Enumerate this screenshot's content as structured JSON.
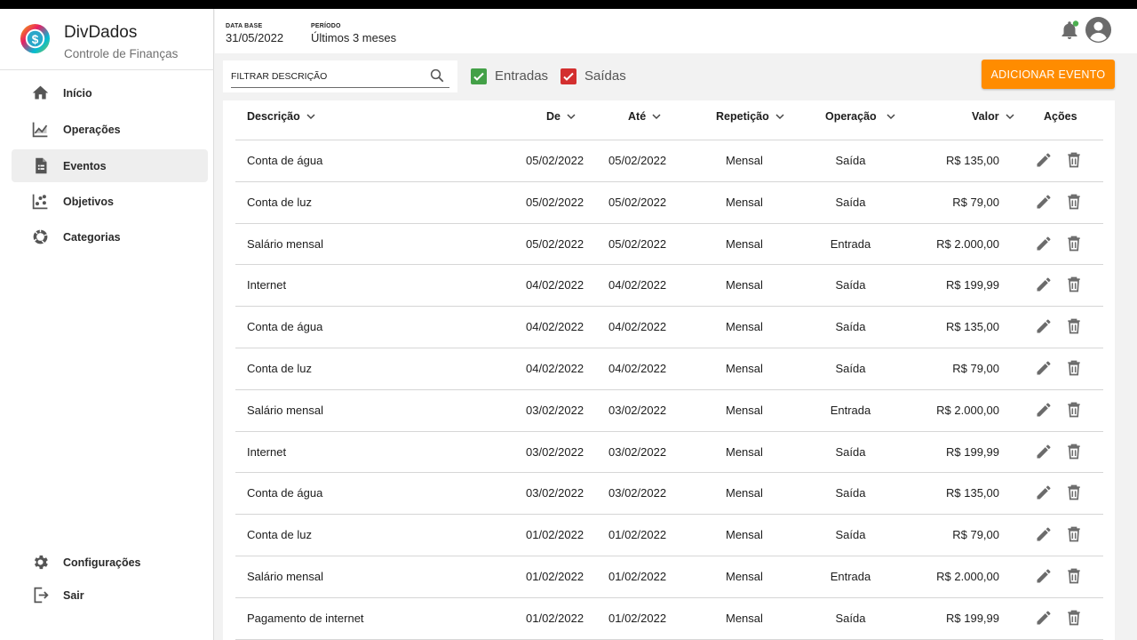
{
  "brand": {
    "title": "DivDados",
    "subtitle": "Controle de Finanças"
  },
  "nav": {
    "items": [
      {
        "label": "Início",
        "icon": "home-icon"
      },
      {
        "label": "Operações",
        "icon": "chart-line-icon"
      },
      {
        "label": "Eventos",
        "icon": "document-icon",
        "active": true
      },
      {
        "label": "Objetivos",
        "icon": "scatter-icon"
      },
      {
        "label": "Categorias",
        "icon": "donut-icon"
      }
    ],
    "bottom": [
      {
        "label": "Configurações",
        "icon": "gear-icon"
      },
      {
        "label": "Sair",
        "icon": "logout-icon"
      }
    ]
  },
  "header": {
    "database_label": "DATA BASE",
    "database_value": "31/05/2022",
    "period_label": "PERÍODO",
    "period_value": "Últimos 3 meses"
  },
  "filters": {
    "description_placeholder": "FILTRAR DESCRIÇÃO",
    "entradas_label": "Entradas",
    "entradas_checked": true,
    "saidas_label": "Saídas",
    "saidas_checked": true,
    "add_button": "ADICIONAR EVENTO"
  },
  "colors": {
    "accent": "#ff8c00",
    "entradas": "#43a047",
    "saidas": "#d32f2f",
    "notification": "#4caf50"
  },
  "table": {
    "columns": [
      "Descrição",
      "De",
      "Até",
      "Repetição",
      "Operação",
      "Valor",
      "Ações"
    ],
    "rows": [
      {
        "descricao": "Conta de água",
        "de": "05/02/2022",
        "ate": "05/02/2022",
        "repeticao": "Mensal",
        "operacao": "Saída",
        "valor": "R$ 135,00"
      },
      {
        "descricao": "Conta de luz",
        "de": "05/02/2022",
        "ate": "05/02/2022",
        "repeticao": "Mensal",
        "operacao": "Saída",
        "valor": "R$ 79,00"
      },
      {
        "descricao": "Salário mensal",
        "de": "05/02/2022",
        "ate": "05/02/2022",
        "repeticao": "Mensal",
        "operacao": "Entrada",
        "valor": "R$ 2.000,00"
      },
      {
        "descricao": "Internet",
        "de": "04/02/2022",
        "ate": "04/02/2022",
        "repeticao": "Mensal",
        "operacao": "Saída",
        "valor": "R$ 199,99"
      },
      {
        "descricao": "Conta de água",
        "de": "04/02/2022",
        "ate": "04/02/2022",
        "repeticao": "Mensal",
        "operacao": "Saída",
        "valor": "R$ 135,00"
      },
      {
        "descricao": "Conta de luz",
        "de": "04/02/2022",
        "ate": "04/02/2022",
        "repeticao": "Mensal",
        "operacao": "Saída",
        "valor": "R$ 79,00"
      },
      {
        "descricao": "Salário mensal",
        "de": "03/02/2022",
        "ate": "03/02/2022",
        "repeticao": "Mensal",
        "operacao": "Entrada",
        "valor": "R$ 2.000,00"
      },
      {
        "descricao": "Internet",
        "de": "03/02/2022",
        "ate": "03/02/2022",
        "repeticao": "Mensal",
        "operacao": "Saída",
        "valor": "R$ 199,99"
      },
      {
        "descricao": "Conta de água",
        "de": "03/02/2022",
        "ate": "03/02/2022",
        "repeticao": "Mensal",
        "operacao": "Saída",
        "valor": "R$ 135,00"
      },
      {
        "descricao": "Conta de luz",
        "de": "01/02/2022",
        "ate": "01/02/2022",
        "repeticao": "Mensal",
        "operacao": "Saída",
        "valor": "R$ 79,00"
      },
      {
        "descricao": "Salário mensal",
        "de": "01/02/2022",
        "ate": "01/02/2022",
        "repeticao": "Mensal",
        "operacao": "Entrada",
        "valor": "R$ 2.000,00"
      },
      {
        "descricao": "Pagamento de internet",
        "de": "01/02/2022",
        "ate": "01/02/2022",
        "repeticao": "Mensal",
        "operacao": "Saída",
        "valor": "R$ 199,99"
      }
    ]
  }
}
